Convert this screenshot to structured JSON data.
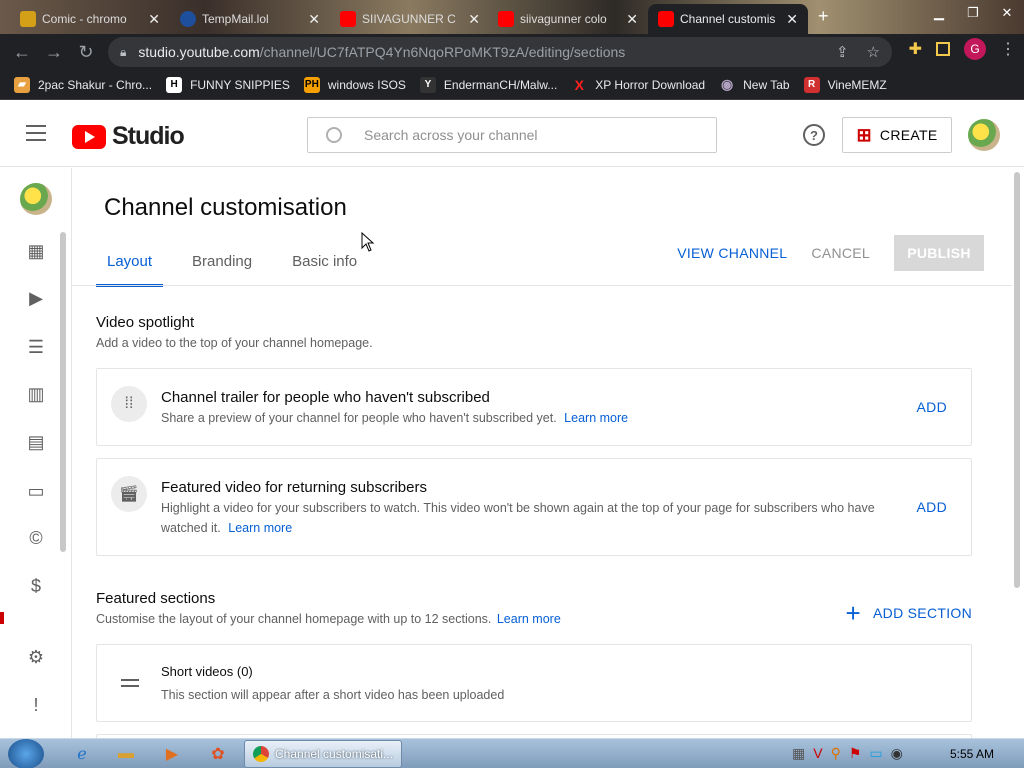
{
  "browser": {
    "tabs": [
      {
        "title": "Comic - chromo",
        "color": "#d4a017"
      },
      {
        "title": "TempMail.lol",
        "color": "#1e4f9c"
      },
      {
        "title": "SIIVAGUNNER C",
        "color": "#ff0000"
      },
      {
        "title": "siivagunner colo",
        "color": "#ff0000"
      },
      {
        "title": "Channel customis",
        "color": "#ff0000"
      }
    ],
    "new_tab": "+",
    "url_host": "studio.youtube.com",
    "url_path": "/channel/UC7fATPQ4Yn6NqoRPoMKT9zA/editing/sections",
    "profile_initial": "G",
    "bookmarks": [
      {
        "label": "2pac Shakur - Chro...",
        "icon": "folder-icon",
        "color": "#e8a040",
        "glyph": "▰"
      },
      {
        "label": "FUNNY SNIPPIES",
        "icon": "h-icon",
        "color": "#ffffff",
        "glyph": "H"
      },
      {
        "label": "windows ISOS",
        "icon": "ph-icon",
        "color": "#f5a000",
        "glyph": "PH"
      },
      {
        "label": "EndermanCH/Malw...",
        "icon": "yp-icon",
        "color": "#333333",
        "glyph": "Y"
      },
      {
        "label": "XP Horror Download",
        "icon": "x-icon",
        "color": "#ff2020",
        "glyph": "X"
      },
      {
        "label": "New Tab",
        "icon": "globe-icon",
        "color": "#b0a0c0",
        "glyph": "◉"
      },
      {
        "label": "VineMEMZ",
        "icon": "r-icon",
        "color": "#d03030",
        "glyph": "R"
      }
    ]
  },
  "studio": {
    "logo_text": "Studio",
    "search_placeholder": "Search across your channel",
    "help": "?",
    "create": "CREATE"
  },
  "page": {
    "title": "Channel customisation",
    "tabs": [
      "Layout",
      "Branding",
      "Basic info"
    ],
    "active_tab": 0,
    "actions": {
      "view_channel": "VIEW CHANNEL",
      "cancel": "CANCEL",
      "publish": "PUBLISH"
    }
  },
  "spotlight": {
    "title": "Video spotlight",
    "desc": "Add a video to the top of your channel homepage.",
    "cards": [
      {
        "title": "Channel trailer for people who haven't subscribed",
        "desc": "Share a preview of your channel for people who haven't subscribed yet.",
        "learn": "Learn more",
        "action": "ADD"
      },
      {
        "title": "Featured video for returning subscribers",
        "desc": "Highlight a video for your subscribers to watch. This video won't be shown again at the top of your page for subscribers who have watched it.",
        "learn": "Learn more",
        "action": "ADD"
      }
    ]
  },
  "featured": {
    "title": "Featured sections",
    "desc": "Customise the layout of your channel homepage with up to 12 sections.",
    "learn": "Learn more",
    "add_section": "ADD SECTION",
    "sections": [
      {
        "title": "Short videos (0)",
        "desc": "This section will appear after a short video has been uploaded"
      }
    ]
  },
  "taskbar": {
    "task_label": "Channel customisati...",
    "clock": "5:55 AM"
  }
}
